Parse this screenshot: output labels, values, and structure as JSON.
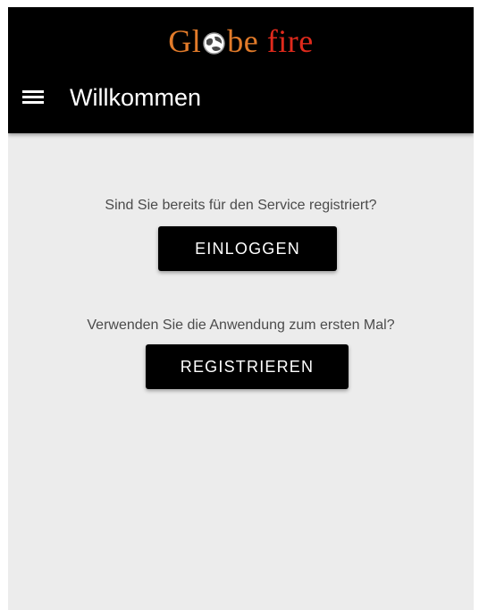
{
  "header": {
    "logo_globe_before": "Gl",
    "logo_globe_after": "be",
    "logo_fire": "fire",
    "title": "Willkommen",
    "menu_icon": "hamburger-menu-icon"
  },
  "main": {
    "login_prompt": "Sind Sie bereits für den Service registriert?",
    "login_button": "EINLOGGEN",
    "register_prompt": "Verwenden Sie die Anwendung zum ersten Mal?",
    "register_button": "REGISTRIEREN"
  },
  "colors": {
    "appbar": "#000000",
    "background": "#ececec",
    "button": "#000000",
    "logo_globe": "#e27b2a",
    "logo_fire": "#e02a1c"
  }
}
